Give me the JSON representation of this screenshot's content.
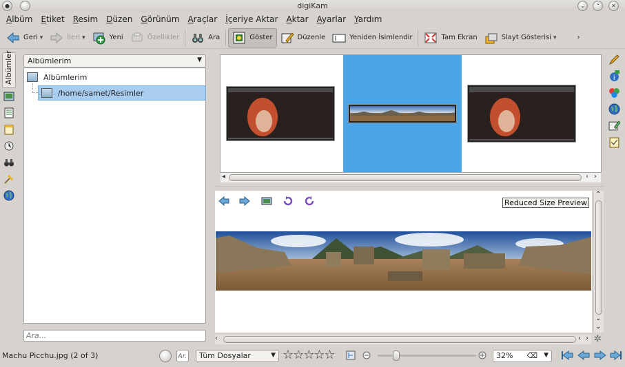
{
  "window": {
    "title": "digiKam"
  },
  "menu": [
    "Albüm",
    "Etiket",
    "Resim",
    "Düzen",
    "Görünüm",
    "Araçlar",
    "İçeriye Aktar",
    "Aktar",
    "Ayarlar",
    "Yardım"
  ],
  "toolbar": {
    "back": "Geri",
    "forward": "İleri",
    "new": "Yeni",
    "properties": "Özellikler",
    "search": "Ara",
    "view": "Göster",
    "edit": "Düzenle",
    "rename": "Yeniden İsimlendir",
    "fullscreen": "Tam Ekran",
    "slideshow": "Slayt Gösterisi",
    "more": "›"
  },
  "left_tabs": {
    "albums_label": "Albümler"
  },
  "album_panel": {
    "combo_value": "Albümlerim",
    "tree": [
      {
        "label": "Albümlerim"
      },
      {
        "label": "/home/samet/Resimler"
      }
    ],
    "search_placeholder": "Ara..."
  },
  "preview": {
    "badge": "Reduced Size Preview"
  },
  "status": {
    "file_info": "Machu Picchu.jpg (2 of 3)",
    "text_filter_placeholder": "Ar.",
    "file_filter": "Tüm Dosyalar",
    "rating_stars": "☆☆☆☆☆",
    "zoom": "32%"
  },
  "colors": {
    "selection": "#4aa4e5",
    "tree_selection": "#a9cdef"
  }
}
